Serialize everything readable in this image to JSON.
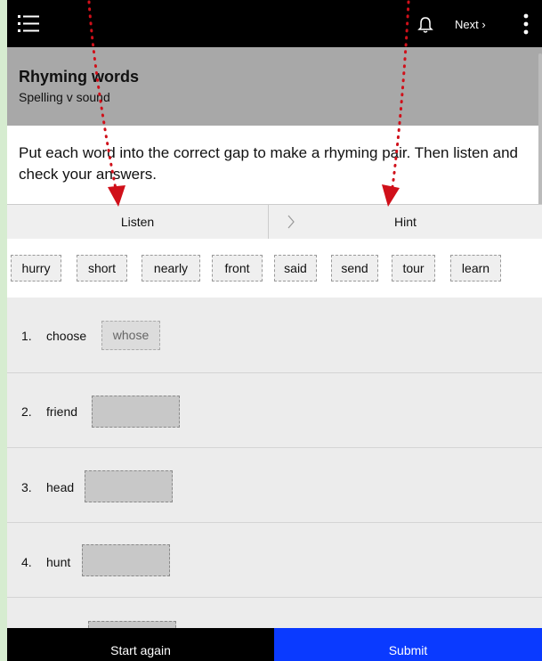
{
  "topbar": {
    "menu_icon": "hamburger-list-icon",
    "bell_icon": "bell-icon",
    "next_label": "Next ›",
    "more_icon": "vertical-dots-icon"
  },
  "header": {
    "title": "Rhyming words",
    "subtitle": "Spelling v sound"
  },
  "instructions": "Put each word into the correct gap to make a rhyming pair. Then listen and check your answers.",
  "tabs": {
    "listen": "Listen",
    "hint": "Hint",
    "chevron_icon": "chevron-right-icon"
  },
  "word_bank": [
    "hurry",
    "short",
    "nearly",
    "front",
    "said",
    "send",
    "tour",
    "learn"
  ],
  "items": [
    {
      "number": "1.",
      "word": "choose",
      "answer": "whose"
    },
    {
      "number": "2.",
      "word": "friend",
      "answer": ""
    },
    {
      "number": "3.",
      "word": "head",
      "answer": ""
    },
    {
      "number": "4.",
      "word": "hunt",
      "answer": ""
    }
  ],
  "footer": {
    "start_again": "Start again",
    "submit": "Submit"
  },
  "colors": {
    "topbar": "#000000",
    "header": "#a8a8a8",
    "submit": "#0a3aff",
    "annotation_arrow": "#d0101a",
    "outer_background": "#d6ecd0"
  }
}
